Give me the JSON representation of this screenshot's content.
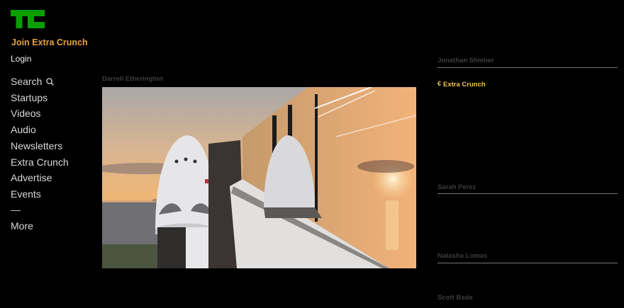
{
  "brand": {
    "logo_text": "TC",
    "logo_color": "#0a9e01"
  },
  "header": {
    "join_label": "Join Extra Crunch",
    "login_label": "Login",
    "accent_color": "#e8a33d"
  },
  "nav": {
    "search_label": "Search",
    "items": [
      "Startups",
      "Videos",
      "Audio",
      "Newsletters",
      "Extra Crunch",
      "Advertise",
      "Events"
    ],
    "more_label": "More"
  },
  "main": {
    "author": "Darrell Etherington",
    "image_icon": "spacex-crew-dragon-photo"
  },
  "sidebar": {
    "authors": [
      "Jonathan Shieber",
      "Sarah Perez",
      "Natasha Lomas",
      "Scott Bade"
    ],
    "extra_crunch_label": "Extra Crunch",
    "extra_crunch_icon": "extra-crunch-icon",
    "extra_crunch_color": "#f5c74a"
  }
}
